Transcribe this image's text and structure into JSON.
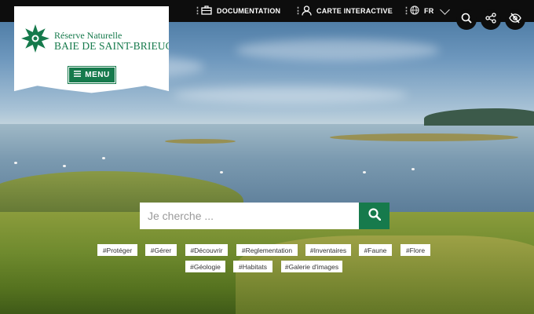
{
  "topbar": {
    "links": [
      {
        "label": "DOCUMENTATION",
        "icon": "briefcase-icon"
      },
      {
        "label": "CARTE INTERACTIVE",
        "icon": "person-icon"
      },
      {
        "label": "FR",
        "icon": "globe-icon"
      }
    ],
    "action_icons": [
      "search-icon",
      "share-icon",
      "eye-slash-icon"
    ]
  },
  "logo": {
    "line1": "Réserve Naturelle",
    "line2": "BAIE DE SAINT-BRIEUC"
  },
  "menu": {
    "label": "MENU"
  },
  "search": {
    "placeholder": "Je cherche ..."
  },
  "tags": {
    "row1": [
      "#Protéger",
      "#Gérer",
      "#Découvrir",
      "#Reglementation",
      "#Inventaires",
      "#Faune",
      "#Flore"
    ],
    "row2": [
      "#Géologie",
      "#Habitats",
      "#Galerie d'images"
    ]
  },
  "colors": {
    "brand_green": "#167a4c",
    "topbar_bg": "#0d0d0d"
  }
}
